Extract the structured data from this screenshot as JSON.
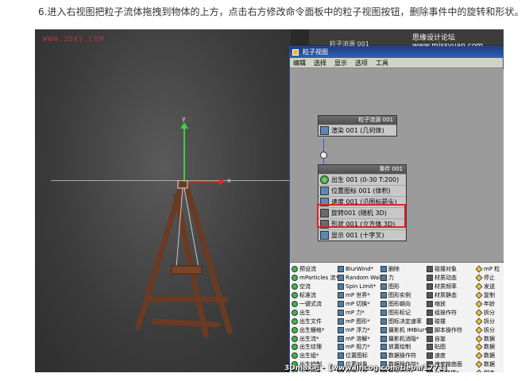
{
  "caption": "6.进入右视图把粒子流体拖拽到物体的上方，点击右方修改命令面板中的粒子视图按钮，删除事件中的旋转和形状。",
  "viewport": {
    "watermark": "WWW.3DXY.COM",
    "axis_y": "y",
    "axis_x": "x"
  },
  "topbar": {
    "field": "粒子流源 001",
    "overlay": "思缘设计论坛 www.missyuan.com"
  },
  "particle_view": {
    "title": "粒子视图",
    "menu": [
      "编辑",
      "选择",
      "显示",
      "选项",
      "工具"
    ],
    "source_node": {
      "header": "粒子流源 001",
      "ops": [
        "渲染 001 (几何体)"
      ]
    },
    "event_node": {
      "header": "事件 001",
      "ops": [
        "出生 001 (0-30 T:200)",
        "位置图标 001 (体积)",
        "速度 001 (沿图标箭头)",
        "旋转001 (随机 3D)",
        "形状 001 (立方体 3D)",
        "显示 001 (十字叉)"
      ]
    },
    "depot": [
      [
        "预设流",
        "BlurWind*",
        "删除",
        "碰撞对象",
        "mP 粒"
      ],
      [
        "mParticles 流*",
        "Random Walk*",
        "力",
        "材质动态",
        "停止"
      ],
      [
        "空流",
        "Spin Limit*",
        "图形",
        "材质频率",
        "发送"
      ],
      [
        "标准流",
        "mP 世界*",
        "图形实例",
        "材质静态",
        "复制"
      ],
      [
        "一键式流",
        "mP 切换*",
        "图形朝向",
        "缩放",
        "年龄"
      ],
      [
        "出生",
        "mP 力*",
        "图形标记",
        "组操作符",
        "拆分"
      ],
      [
        "出生文件",
        "mP 图形*",
        "图标决定速率",
        "碰撞",
        "拆分"
      ],
      [
        "出生栅格*",
        "mP 浮力*",
        "摄影机 IMBlur*",
        "脚本操作符",
        "拆分"
      ],
      [
        "出生流*",
        "mP 溶解*",
        "摄影机消隐*",
        "自旋",
        "数据"
      ],
      [
        "出生纹理",
        "mP 阻力*",
        "放置绘制",
        "贴图",
        "数据"
      ],
      [
        "出生组*",
        "位置图标",
        "数据操作符",
        "速度",
        "数据"
      ],
      [
        "出生绘制",
        "位置对象",
        "数据操作符*",
        "速度按曲面",
        "数据"
      ],
      [
        "出生脚本",
        "保持分离",
        "数据预设*",
        "mP 碰撞*",
        "脚本"
      ],
      [
        "初始状态",
        "停止*",
        "旋转",
        "mP 粒子间...",
        "碰撞"
      ]
    ]
  },
  "bottom_watermark": "3Dmax吧 -【www.lincog.com/tieba/1771】"
}
